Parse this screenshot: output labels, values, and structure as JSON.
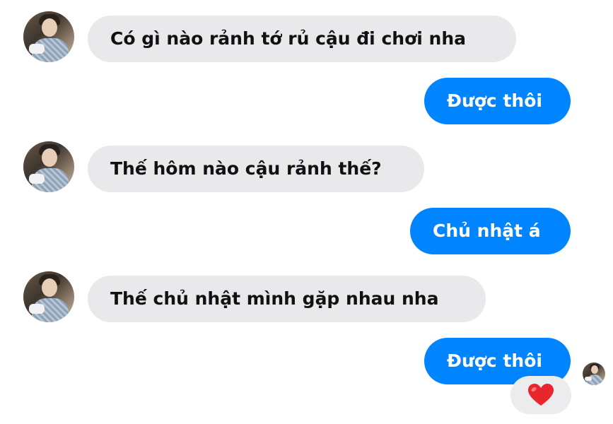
{
  "messages": [
    {
      "sender": "other",
      "text": "Có gì nào rảnh tớ rủ cậu đi chơi nha"
    },
    {
      "sender": "me",
      "text": "Được thôi"
    },
    {
      "sender": "other",
      "text": "Thế hôm nào cậu rảnh thế?"
    },
    {
      "sender": "me",
      "text": "Chủ nhật á"
    },
    {
      "sender": "other",
      "text": "Thế chủ nhật mình gặp nhau nha"
    },
    {
      "sender": "me",
      "text": "Được thôi"
    }
  ],
  "reaction": {
    "emoji": "❤️",
    "icon": "heart-icon",
    "color": "#e8262d"
  },
  "colors": {
    "outgoing_bubble": "#0084ff",
    "incoming_bubble": "#e9e9eb",
    "background": "#ffffff"
  }
}
